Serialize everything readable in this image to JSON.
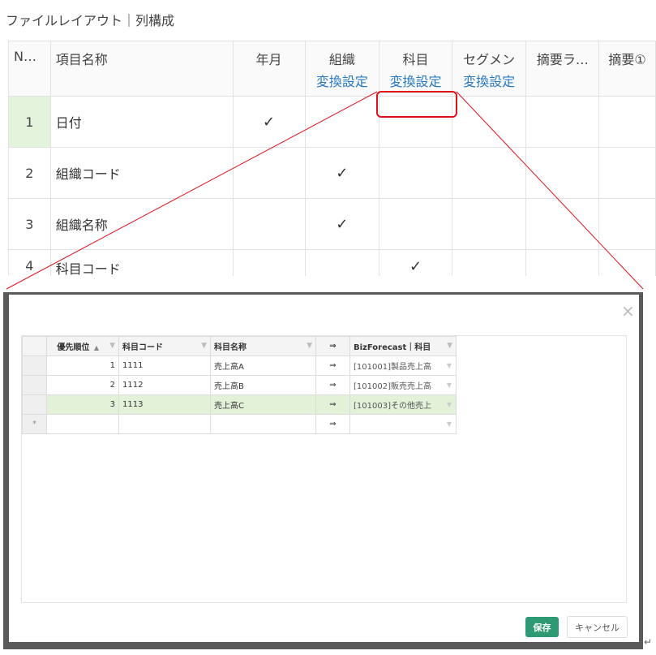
{
  "top": {
    "title": "ファイルレイアウト｜列構成",
    "columns": [
      "N…",
      "項目名称",
      "年月",
      "組織",
      "科目",
      "セグメン",
      "摘要ラ…",
      "摘要①"
    ],
    "convert_link": "変換設定",
    "rows": [
      {
        "no": "1",
        "name": "日付",
        "check_col": "年月"
      },
      {
        "no": "2",
        "name": "組織コード",
        "check_col": "組織"
      },
      {
        "no": "3",
        "name": "組織名称",
        "check_col": "組織"
      },
      {
        "no": "4",
        "name": "科目コード",
        "check_col": "科目"
      }
    ],
    "checkmark": "✓"
  },
  "modal": {
    "close_icon": "×",
    "columns": {
      "priority": "優先順位",
      "code": "科目コード",
      "name": "科目名称",
      "arrow": "⇒",
      "target": "BizForecast｜科目"
    },
    "sort_icon": "▲",
    "filter_icon": "▼",
    "rows": [
      {
        "priority": "1",
        "code": "1111",
        "name": "売上高A",
        "arrow": "⇒",
        "target": "[101001]製品売上高"
      },
      {
        "priority": "2",
        "code": "1112",
        "name": "売上高B",
        "arrow": "⇒",
        "target": "[101002]販売売上高"
      },
      {
        "priority": "3",
        "code": "1113",
        "name": "売上高C",
        "arrow": "⇒",
        "target": "[101003]その他売上"
      }
    ],
    "new_row_marker": "*",
    "new_row_arrow": "⇒",
    "save_label": "保存",
    "cancel_label": "キャンセル"
  },
  "colors": {
    "accent_link": "#2878c0",
    "save_button": "#2d9a73",
    "highlight": "#e0101a",
    "selected_row": "#e3f1d9"
  },
  "return_mark": "↵"
}
